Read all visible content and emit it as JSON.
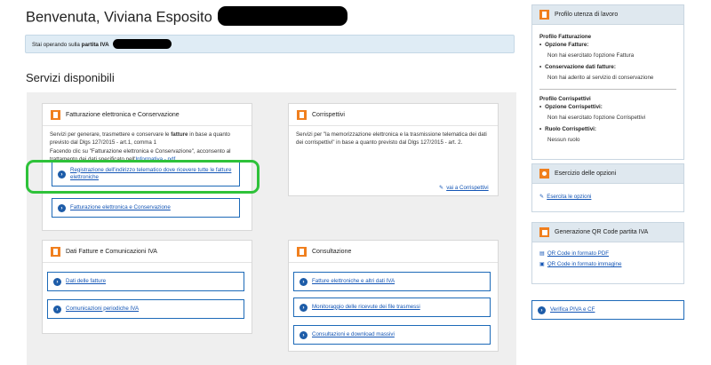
{
  "header": {
    "welcome": "Benvenuta, Viviana Esposito"
  },
  "notice": {
    "prefix": "Stai operando sulla",
    "bold": "partita IVA"
  },
  "section_title": "Servizi disponibili",
  "cards": {
    "fatturazione": {
      "title": "Fatturazione elettronica e Conservazione",
      "desc_1": "Servizi per generare, trasmettere e conservare le",
      "desc_bold": "fatture",
      "desc_2": "in base a quanto previsto dal Dlgs 127/2015 - art.1, comma 1",
      "desc_3": "Facendo clic su \"Fatturazione elettronica e Conservazione\", acconsento al trattamento dei dati specificato nell'",
      "desc_link": "Informativa - pdf",
      "btn_registrazione": "Registrazione dell'indirizzo telematico dove ricevere tutte le fatture elettroniche",
      "btn_fatturazione": "Fatturazione elettronica e Conservazione"
    },
    "corrispettivi": {
      "title": "Corrispettivi",
      "desc": "Servizi per \"la memorizzazione elettronica e la trasmissione telematica dei dati dei corrispettivi\" in base a quanto previsto dal Dlgs 127/2015 - art. 2.",
      "link": "vai a Corrispettivi"
    },
    "dati_fatture": {
      "title": "Dati Fatture e Comunicazioni IVA",
      "btn_dati": "Dati delle fatture",
      "btn_comunicazioni": "Comunicazioni periodiche IVA"
    },
    "consultazione": {
      "title": "Consultazione",
      "btn_fatture": "Fatture elettroniche e altri dati IVA",
      "btn_monitoraggio": "Monitoraggio delle ricevute dei file trasmessi",
      "btn_consultazioni": "Consultazioni e download massivi"
    }
  },
  "profilo": {
    "title": "Profilo utenza di lavoro",
    "fatt_title": "Profilo Fatturazione",
    "opzione_label": "Opzione Fatture:",
    "opzione_val": "Non hai esercitato l'opzione Fattura",
    "conserv_label": "Conservazione dati fatture:",
    "conserv_val": "Non hai aderito al servizio di conservazione",
    "corr_title": "Profilo Corrispettivi",
    "opz_corr_label": "Opzione Corrispettivi:",
    "opz_corr_val": "Non hai esercitato l'opzione Corrispettivi",
    "ruolo_label": "Ruolo Corrispettivi:",
    "ruolo_val": "Nessun ruolo"
  },
  "esercizio": {
    "title": "Esercizio delle opzioni",
    "link": "Esercita le opzioni"
  },
  "qr": {
    "title": "Generazione QR Code partita IVA",
    "pdf": "QR Code in formato PDF",
    "img": "QR Code in formato immagine"
  },
  "verifica": {
    "label": "Verifica PIVA e CF"
  }
}
